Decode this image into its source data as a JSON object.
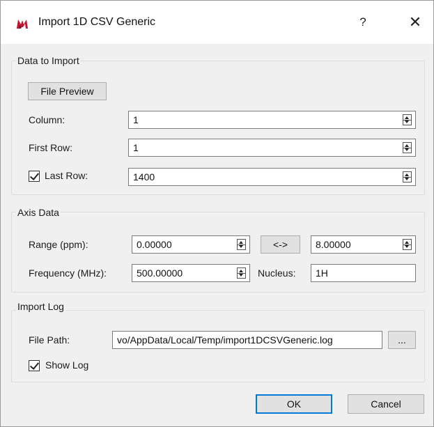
{
  "window": {
    "title": "Import 1D CSV Generic",
    "help_symbol": "?",
    "close_symbol": "✕"
  },
  "data_to_import": {
    "group_title": "Data to Import",
    "file_preview_label": "File Preview",
    "column_label": "Column:",
    "column_value": "1",
    "first_row_label": "First Row:",
    "first_row_value": "1",
    "last_row_label": "Last Row:",
    "last_row_checked": true,
    "last_row_value": "1400"
  },
  "axis_data": {
    "group_title": "Axis Data",
    "range_label": "Range (ppm):",
    "range_from": "0.00000",
    "swap_label": "<->",
    "range_to": "8.00000",
    "frequency_label": "Frequency (MHz):",
    "frequency_value": "500.00000",
    "nucleus_label": "Nucleus:",
    "nucleus_value": "1H"
  },
  "import_log": {
    "group_title": "Import Log",
    "file_path_label": "File Path:",
    "file_path_value": "vo/AppData/Local/Temp/import1DCSVGeneric.log",
    "browse_label": "...",
    "show_log_label": "Show Log",
    "show_log_checked": true
  },
  "footer": {
    "ok_label": "OK",
    "cancel_label": "Cancel"
  },
  "colors": {
    "dialog_bg": "#f0f0f0",
    "title_bg": "#ffffff",
    "default_button_border": "#0078d7",
    "app_icon_red": "#c8102e"
  },
  "icons": {
    "app": "red-mnova-logo-icon",
    "help": "question-mark-icon",
    "close": "close-icon",
    "spin": "spinner-arrows-icon",
    "check": "checkmark-icon"
  }
}
